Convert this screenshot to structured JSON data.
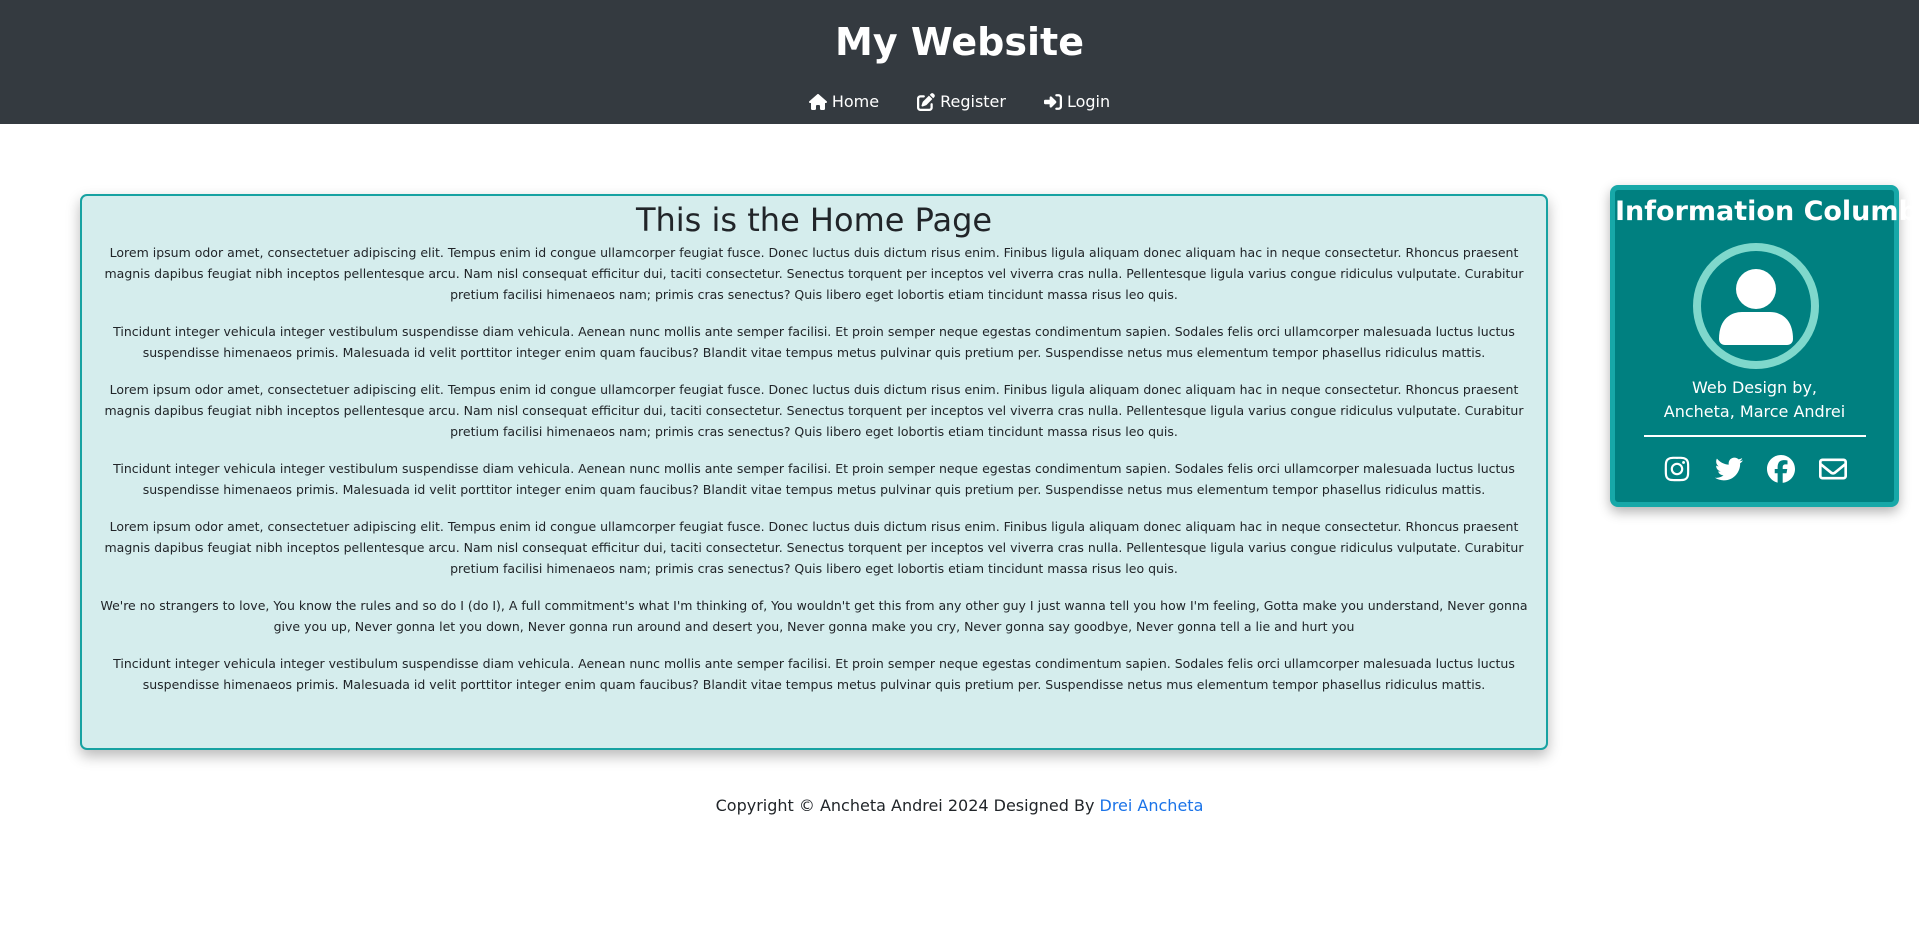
{
  "header": {
    "title": "My Website",
    "nav": [
      {
        "label": "Home",
        "icon": "home-icon"
      },
      {
        "label": "Register",
        "icon": "edit-icon"
      },
      {
        "label": "Login",
        "icon": "login-icon"
      }
    ]
  },
  "main": {
    "heading": "This is the Home Page",
    "paragraphs": [
      "Lorem ipsum odor amet, consectetuer adipiscing elit. Tempus enim id congue ullamcorper feugiat fusce. Donec luctus duis dictum risus enim. Finibus ligula aliquam donec aliquam hac in neque consectetur. Rhoncus praesent magnis dapibus feugiat nibh inceptos pellentesque arcu. Nam nisl consequat efficitur dui, taciti consectetur. Senectus torquent per inceptos vel viverra cras nulla. Pellentesque ligula varius congue ridiculus vulputate. Curabitur pretium facilisi himenaeos nam; primis cras senectus? Quis libero eget lobortis etiam tincidunt massa risus leo quis.",
      "Tincidunt integer vehicula integer vestibulum suspendisse diam vehicula. Aenean nunc mollis ante semper facilisi. Et proin semper neque egestas condimentum sapien. Sodales felis orci ullamcorper malesuada luctus luctus suspendisse himenaeos primis. Malesuada id velit porttitor integer enim quam faucibus? Blandit vitae tempus metus pulvinar quis pretium per. Suspendisse netus mus elementum tempor phasellus ridiculus mattis.",
      "Lorem ipsum odor amet, consectetuer adipiscing elit. Tempus enim id congue ullamcorper feugiat fusce. Donec luctus duis dictum risus enim. Finibus ligula aliquam donec aliquam hac in neque consectetur. Rhoncus praesent magnis dapibus feugiat nibh inceptos pellentesque arcu. Nam nisl consequat efficitur dui, taciti consectetur. Senectus torquent per inceptos vel viverra cras nulla. Pellentesque ligula varius congue ridiculus vulputate. Curabitur pretium facilisi himenaeos nam; primis cras senectus? Quis libero eget lobortis etiam tincidunt massa risus leo quis.",
      "Tincidunt integer vehicula integer vestibulum suspendisse diam vehicula. Aenean nunc mollis ante semper facilisi. Et proin semper neque egestas condimentum sapien. Sodales felis orci ullamcorper malesuada luctus luctus suspendisse himenaeos primis. Malesuada id velit porttitor integer enim quam faucibus? Blandit vitae tempus metus pulvinar quis pretium per. Suspendisse netus mus elementum tempor phasellus ridiculus mattis.",
      "Lorem ipsum odor amet, consectetuer adipiscing elit. Tempus enim id congue ullamcorper feugiat fusce. Donec luctus duis dictum risus enim. Finibus ligula aliquam donec aliquam hac in neque consectetur. Rhoncus praesent magnis dapibus feugiat nibh inceptos pellentesque arcu. Nam nisl consequat efficitur dui, taciti consectetur. Senectus torquent per inceptos vel viverra cras nulla. Pellentesque ligula varius congue ridiculus vulputate. Curabitur pretium facilisi himenaeos nam; primis cras senectus? Quis libero eget lobortis etiam tincidunt massa risus leo quis.",
      "We're no strangers to love, You know the rules and so do I (do I), A full commitment's what I'm thinking of, You wouldn't get this from any other guy I just wanna tell you how I'm feeling, Gotta make you understand, Never gonna give you up, Never gonna let you down, Never gonna run around and desert you, Never gonna make you cry, Never gonna say goodbye, Never gonna tell a lie and hurt you",
      "Tincidunt integer vehicula integer vestibulum suspendisse diam vehicula. Aenean nunc mollis ante semper facilisi. Et proin semper neque egestas condimentum sapien. Sodales felis orci ullamcorper malesuada luctus luctus suspendisse himenaeos primis. Malesuada id velit porttitor integer enim quam faucibus? Blandit vitae tempus metus pulvinar quis pretium per. Suspendisse netus mus elementum tempor phasellus ridiculus mattis."
    ]
  },
  "sidebar": {
    "title": "Information Columb",
    "avatar_icon": "user-avatar-icon",
    "credit_line1": "Web Design by,",
    "credit_line2": "Ancheta, Marce Andrei",
    "socials": [
      "instagram-icon",
      "twitter-icon",
      "facebook-icon",
      "envelope-icon"
    ]
  },
  "footer": {
    "text": "Copyright © Ancheta Andrei 2024 Designed By ",
    "link_label": "Drei Ancheta"
  },
  "colors": {
    "header_bg": "#343a40",
    "content_bg": "#d5eded",
    "content_border": "#17a2a2",
    "sidebar_bg": "#008080",
    "link": "#1a73e8"
  }
}
